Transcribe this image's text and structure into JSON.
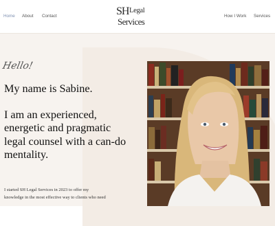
{
  "nav": {
    "left": [
      "Home",
      "About",
      "Contact"
    ],
    "right": [
      "How I Work",
      "Services"
    ],
    "active": "Home"
  },
  "logo": {
    "mark": "SH",
    "line1": "Legal",
    "line2": "Services"
  },
  "hero": {
    "greeting": "Hello!",
    "intro_line": "My name is Sabine.",
    "headline_lines": [
      "I am an experienced,",
      "energetic and pragmatic",
      "legal counsel with a can-do",
      "mentality."
    ],
    "paragraph_lines": [
      "I started SH Legal Services in 2023 to offer my",
      "knowledge in the most effective way to clients who need"
    ]
  },
  "colors": {
    "accent_nav": "#7d8fb0",
    "hero_bg": "#f7f3ef",
    "text": "#111111"
  }
}
